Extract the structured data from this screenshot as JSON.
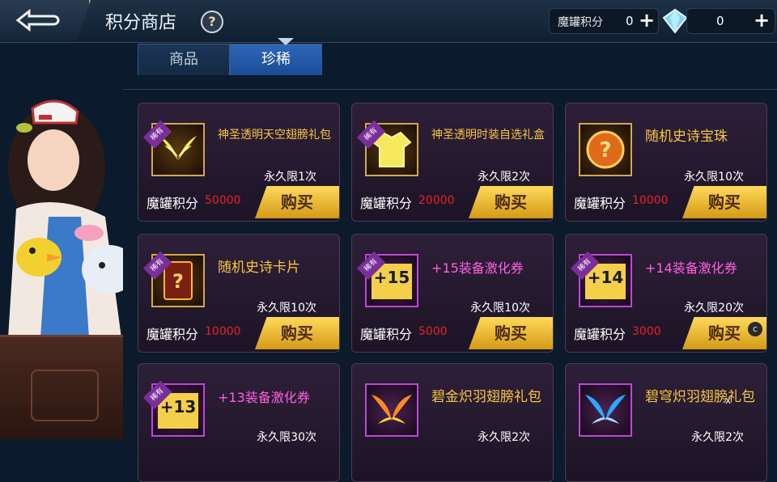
{
  "header": {
    "title": "积分商店",
    "help": "?"
  },
  "currency": {
    "magic_label": "魔罐积分",
    "magic_value": "0",
    "plus": "+",
    "diamond_value": "0"
  },
  "tabs": [
    {
      "label": "商品"
    },
    {
      "label": "珍稀"
    }
  ],
  "active_tab": "珍稀",
  "badge_text": "稀有",
  "price_label": "魔罐积分",
  "buy_label": "购买",
  "items": [
    {
      "name": "神圣透明天空翅膀礼包",
      "limit": "永久限1次",
      "price": "50000",
      "icon": "wings-icon"
    },
    {
      "name": "神圣透明时装自选礼盒",
      "limit": "永久限2次",
      "price": "20000",
      "icon": "shirt-icon"
    },
    {
      "name": "随机史诗宝珠",
      "limit": "永久限10次",
      "price": "10000",
      "icon": "orb-icon"
    },
    {
      "name": "随机史诗卡片",
      "limit": "永久限10次",
      "price": "10000",
      "icon": "card-icon"
    },
    {
      "name": "+15装备激化券",
      "limit": "永久限10次",
      "price": "5000",
      "icon": "ticket-15-icon",
      "level": "+15"
    },
    {
      "name": "+14装备激化券",
      "limit": "永久限20次",
      "price": "3000",
      "icon": "ticket-14-icon",
      "level": "+14"
    },
    {
      "name": "+13装备激化券",
      "limit": "永久限30次",
      "icon": "ticket-13-icon",
      "level": "+13"
    },
    {
      "name": "碧金炽羽翅膀礼包",
      "limit": "永久限2次",
      "icon": "gold-wings-icon"
    },
    {
      "name": "碧穹炽羽翅膀礼包",
      "limit": "永久限2次",
      "icon": "blue-wings-icon"
    }
  ],
  "overlay": {
    "close": "x",
    "c": "c"
  },
  "colors": {
    "accent_gold": "#f6c640",
    "price_red": "#e8202a",
    "ticket_magenta": "#ff5fe0",
    "tab_active": "#2e67b8"
  }
}
